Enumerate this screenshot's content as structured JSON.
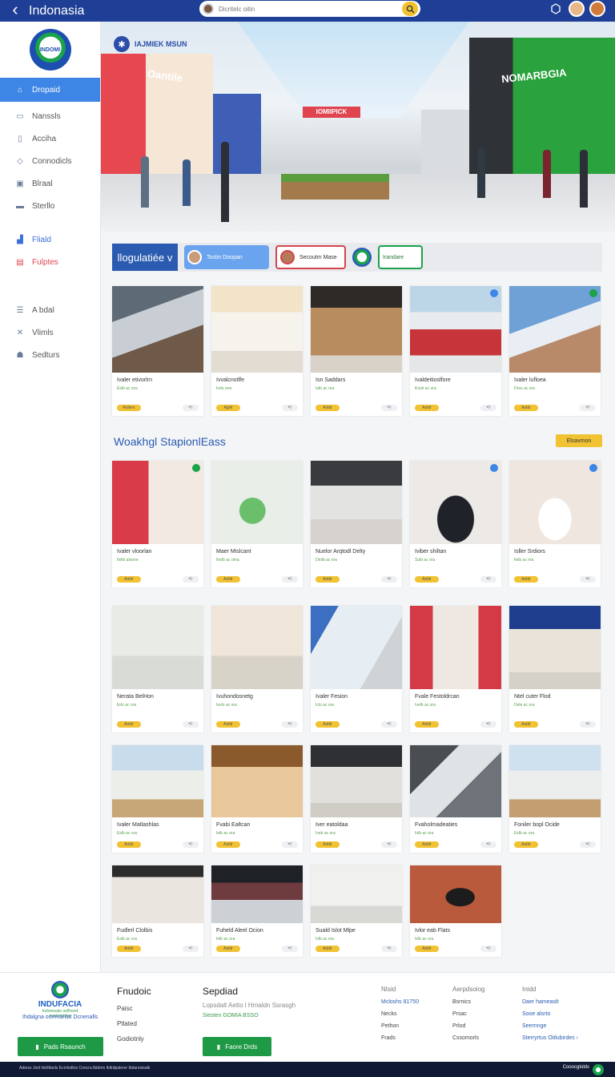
{
  "header": {
    "back_glyph": "‹",
    "title": "Indonasia",
    "search_placeholder": "Dicritelc oitin",
    "search_icon": "search-icon"
  },
  "sidebar": {
    "logo_text": "INDOMI",
    "items": [
      {
        "label": "Dropaid",
        "icon": "home-icon",
        "active": true
      },
      {
        "label": "Nanssls",
        "icon": "list-icon"
      },
      {
        "label": "Acciha",
        "icon": "doc-icon"
      },
      {
        "label": "Connodicls",
        "icon": "shield-icon"
      },
      {
        "label": "Blraal",
        "icon": "image-icon"
      },
      {
        "label": "Sterllo",
        "icon": "card-icon"
      },
      {
        "label": "Fliald",
        "icon": "chart-icon"
      },
      {
        "label": "Fulptes",
        "icon": "tag-icon"
      },
      {
        "label": "A bdal",
        "icon": "menu-icon"
      },
      {
        "label": "Vlimls",
        "icon": "tools-icon"
      },
      {
        "label": "Sedturs",
        "icon": "users-icon"
      }
    ]
  },
  "hero": {
    "badge_text": "IAJMIEK MSUN",
    "left_sign": "Oantile",
    "right_sign": "NOMARBGIA",
    "center_sign": "IOMIIPICK"
  },
  "filterbar": {
    "title": "llogulatiée v",
    "chip_blue": "Tostin Doopan",
    "chip_red": "Secoutm Mase",
    "chip_green": "Irandare"
  },
  "cards_top": [
    {
      "title": "Ivaler etivorlrn",
      "sub": "Eslb ac ons",
      "pill": "Aoliers",
      "act": "•◊"
    },
    {
      "title": "Ivvalcnotlfe",
      "sub": "Irels erer",
      "pill": "Aglilr",
      "act": "•◊"
    },
    {
      "title": "Isn Saddars",
      "sub": "Iulb ac ora",
      "pill": "Aoldr",
      "act": "•◊"
    },
    {
      "title": "Ivaldeitioslfore",
      "sub": "Kosb ac ora",
      "pill": "Aoldr",
      "act": "•◊"
    },
    {
      "title": "Ivaler lufloea",
      "sub": "Dres ac ora",
      "pill": "Aoldr",
      "act": "•◊"
    }
  ],
  "section": {
    "title": "Woakhgl StapionlEass",
    "button": "Elsavmon"
  },
  "cards_row2": [
    {
      "title": "Ivaler vloorlan",
      "sub": "Ilelib aloone",
      "pill": "Aoldr",
      "act": "•◊"
    },
    {
      "title": "Maer Mislcant",
      "sub": "Ilrelb ac otna",
      "pill": "Aoldr",
      "act": "•◊"
    },
    {
      "title": "Nuelor Arqtodl Delty",
      "sub": "Dtolb ac ora",
      "pill": "Aoldr",
      "act": "•◊"
    },
    {
      "title": "Iviber shiltan",
      "sub": "Sulb ac ora",
      "pill": "Aoldr",
      "act": "•◊"
    },
    {
      "title": "Isller Srdiors",
      "sub": "Ilelb ac ora",
      "pill": "Aoldr",
      "act": "•◊"
    }
  ],
  "cards_row3": [
    {
      "title": "Nerata BelHon",
      "sub": "Erlo ac ora",
      "pill": "Aoldr",
      "act": "•◊"
    },
    {
      "title": "Ivuhondosnetg",
      "sub": "Ieslo ac ora",
      "pill": "Aoldr",
      "act": "•◊"
    },
    {
      "title": "Ivaler Fesion",
      "sub": "Iclo ac ora",
      "pill": "Aoldr",
      "act": "•◊"
    },
    {
      "title": "Fvale Festoldrcan",
      "sub": "Ivelb ac ora",
      "pill": "Aoldr",
      "act": "•◊"
    },
    {
      "title": "Ntel cuter Flod",
      "sub": "Dele ac ora",
      "pill": "Aoldr",
      "act": "•◊"
    }
  ],
  "cards_row4": [
    {
      "title": "Ivaler Matlashlas",
      "sub": "Eslb ac ora",
      "pill": "Aoldr",
      "act": "•◊"
    },
    {
      "title": "Fvabi Ealtcan",
      "sub": "Ielb ac ora",
      "pill": "Aoldr",
      "act": "•◊"
    },
    {
      "title": "Iver eatoldaa",
      "sub": "Iveb ac ora",
      "pill": "Aoldr",
      "act": "•◊"
    },
    {
      "title": "Fvaholmadeaties",
      "sub": "Iolb ac ora",
      "pill": "Aoldr",
      "act": "•◊"
    },
    {
      "title": "Foniler bopl Ocide",
      "sub": "Eslb ac ora",
      "pill": "Aoldr",
      "act": "•◊"
    }
  ],
  "cards_row5": [
    {
      "title": "Fudlerl Clolbis",
      "sub": "Eslb ac ora",
      "pill": "Aoldr",
      "act": "•◊"
    },
    {
      "title": "Fuheld Aleel Ocion",
      "sub": "Ielb ac ora",
      "pill": "Aoldr",
      "act": "•◊"
    },
    {
      "title": "Suald Islot Mlpe",
      "sub": "Ivlb ac ora",
      "pill": "Aoldr",
      "act": "•◊"
    },
    {
      "title": "Ivlor eab Flats",
      "sub": "Ielb ac ora",
      "pill": "Aoldr",
      "act": "•◊"
    }
  ],
  "footer": {
    "logo_name": "INDUFACIA",
    "logo_sub": "Indonesian sellhood marketplace",
    "tagline": "Ihdalgna oomnanlat Dcnenalls",
    "button1": "Pads Rsaunch",
    "col1_heading": "Fnudoic",
    "col1_links": [
      "Paisc",
      "Ptlated",
      "Godiotnly"
    ],
    "col2_heading": "Sepdiad",
    "col2_sub": "Lopsdalt Aetto l Hmaldn Ssrasgh",
    "col2_sub2": "Siesten GOMIA BSSO",
    "button2": "Faore Drds",
    "col3_heading": "Ntsid",
    "col3_links": [
      "Mcloshs 81750",
      "Necks",
      "Pethon",
      "Frads"
    ],
    "col4_heading": "Aerpdsoiog",
    "col4_links": [
      "Bsrnics",
      "Prsac",
      "Prlod",
      "Cssomorls"
    ],
    "col5_heading": "Inidd",
    "col5_links": [
      "Daer hameaslt",
      "Sooe alsrto",
      "Seernnge",
      "Sterryrtus Oitlubirdes ›"
    ]
  },
  "bottombar": {
    "left": "Aderss Jool lnk/tltanls  Ecmlodtos  Concra Ibtdnm  Ibilrdpalerer  Ibdarsstsatk",
    "right": "Cooocgtolds"
  },
  "colors": {
    "topbar": "#1e3f95",
    "accent_blue": "#3d86e6",
    "accent_yellow": "#f1c232",
    "accent_green": "#1e9a46"
  }
}
